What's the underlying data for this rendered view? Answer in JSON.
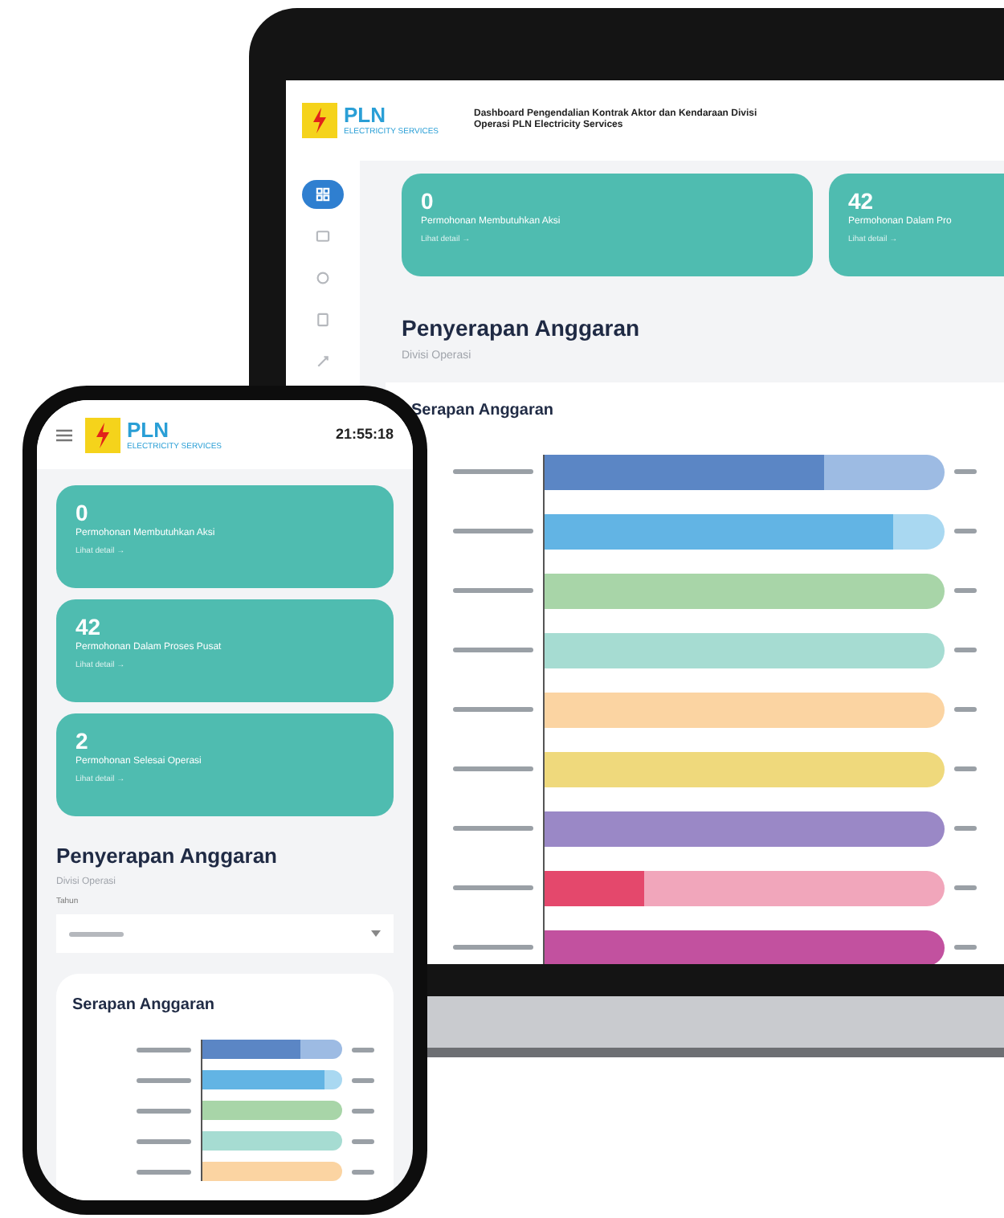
{
  "laptop": {
    "header": {
      "brand": "PLN",
      "brand_subtitle": "ELECTRICITY SERVICES",
      "title": "Dashboard Pengendalian Kontrak Aktor dan Kendaraan Divisi Operasi PLN Electricity Services"
    },
    "sidebar": {
      "items": [
        {
          "selected": true
        },
        {
          "selected": false
        },
        {
          "selected": false
        },
        {
          "selected": false
        },
        {
          "selected": false
        }
      ]
    },
    "cards": [
      {
        "count": "0",
        "label": "Permohonan Membutuhkan Aksi",
        "link": "Lihat detail →"
      },
      {
        "count": "42",
        "label": "Permohonan Dalam Pro",
        "link": "Lihat detail →"
      }
    ],
    "section": {
      "title": "Penyerapan Anggaran",
      "subtitle": "Divisi Operasi"
    },
    "chart": {
      "title": "Serapan Anggaran",
      "bars": [
        {
          "color": "#5b86c5",
          "track": {
            "color": "#9dbbe3"
          },
          "level": 0.7
        },
        {
          "color": "#62b4e4",
          "track": {
            "color": "#a9d8f1"
          },
          "level": 0.87
        },
        {
          "color": "#a8d5a8"
        },
        {
          "color": "#a6dcd2"
        },
        {
          "color": "#fbd4a2"
        },
        {
          "color": "#efd97c"
        },
        {
          "color": "#9a88c6"
        },
        {
          "color": "#e4486c",
          "track": {
            "color": "#f1a6bb"
          },
          "level": 0.25
        },
        {
          "color": "#c2519f"
        }
      ]
    }
  },
  "phone": {
    "header": {
      "brand": "PLN",
      "brand_subtitle": "ELECTRICITY SERVICES",
      "time": "21:55:18"
    },
    "cards": [
      {
        "count": "0",
        "label": "Permohonan Membutuhkan Aksi",
        "link": "Lihat detail →"
      },
      {
        "count": "42",
        "label": "Permohonan Dalam Proses Pusat",
        "link": "Lihat detail →"
      },
      {
        "count": "2",
        "label": "Permohonan Selesai Operasi",
        "link": "Lihat detail →"
      }
    ],
    "section": {
      "title": "Penyerapan Anggaran",
      "subtitle": "Divisi Operasi",
      "filter_label": "Tahun"
    },
    "chart": {
      "title": "Serapan Anggaran",
      "bars": [
        {
          "color": "#5b86c5",
          "track": {
            "color": "#9dbbe3"
          },
          "level": 0.7
        },
        {
          "color": "#62b4e4",
          "track": {
            "color": "#a9d8f1"
          },
          "level": 0.87
        },
        {
          "color": "#a8d5a8"
        },
        {
          "color": "#a6dcd2"
        },
        {
          "color": "#fbd4a2"
        }
      ]
    }
  }
}
